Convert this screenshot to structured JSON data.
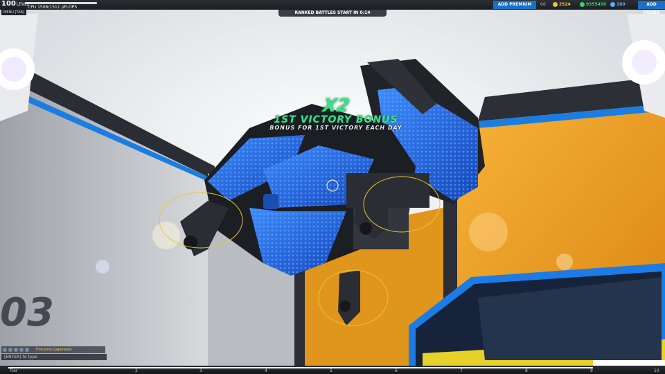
{
  "hud": {
    "level_value": "100",
    "level_label": "LEVEL",
    "cpu": "CPU 1506/1511 pFLOPS",
    "menu": "MENU [TAB]",
    "ranked": "RANKED BATTLES START IN  0:14",
    "add_premium": "ADD PREMIUM",
    "premium_days": "0d",
    "robits": "2524",
    "cosmetic": "9355450",
    "crates": "100",
    "add_funds": "ADD FUNDS"
  },
  "bonus": {
    "multiplier": "X2",
    "title": "1ST VICTORY BONUS",
    "subtitle": "BONUS FOR 1ST VICTORY EACH DAY"
  },
  "garage": {
    "bay_number": "03"
  },
  "chat": {
    "channel": "Everyone (Japanese)",
    "input_hint": "[ENTER] to type"
  },
  "tier_bar": {
    "label": "Tier",
    "ticks": [
      "2",
      "3",
      "4",
      "5",
      "6",
      "7",
      "8",
      "9",
      "10"
    ]
  },
  "colors": {
    "robot_blue": "#1d6fe0",
    "bonus_green": "#38e38a",
    "premium_blue": "#1b6fc5",
    "wall_orange": "#f2a01a"
  }
}
